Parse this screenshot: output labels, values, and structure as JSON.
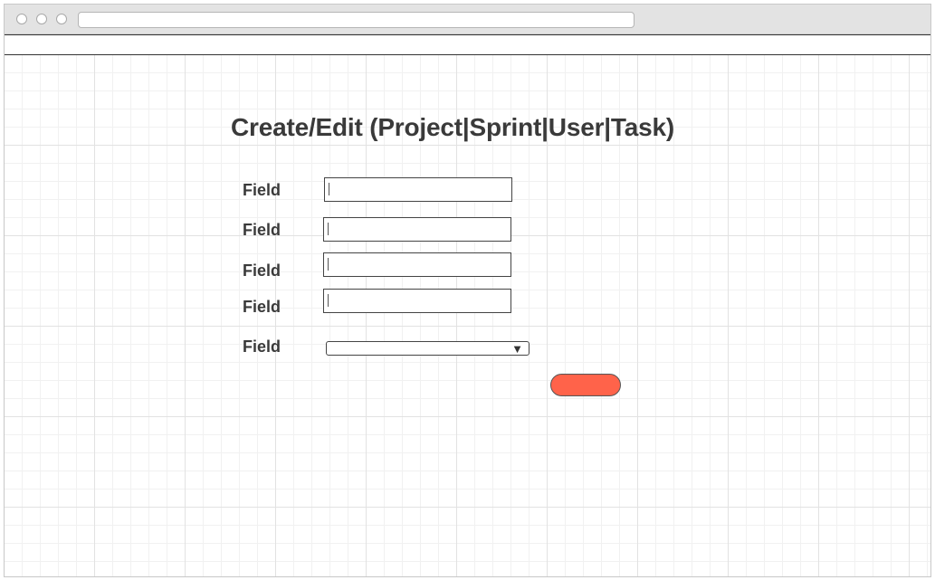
{
  "page": {
    "title": "Create/Edit (Project|Sprint|User|Task)"
  },
  "form": {
    "fields": [
      {
        "label": "Field",
        "value": ""
      },
      {
        "label": "Field",
        "value": ""
      },
      {
        "label": "Field",
        "value": ""
      },
      {
        "label": "Field",
        "value": ""
      }
    ],
    "select": {
      "label": "Field",
      "selected": "",
      "arrow": "▼"
    },
    "submit": {
      "label": ""
    }
  },
  "colors": {
    "button": "#ff634a",
    "text": "#3a3a3a"
  }
}
